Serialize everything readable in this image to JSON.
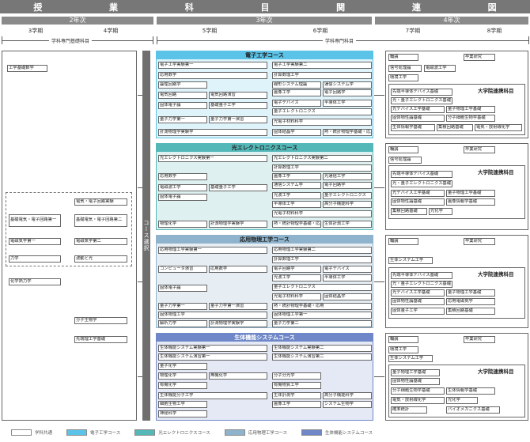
{
  "title_chars": [
    "授",
    "業",
    "科",
    "目",
    "関",
    "連",
    "図"
  ],
  "years": [
    "2年次",
    "3年次",
    "4年次"
  ],
  "semesters": [
    "3学期",
    "4学期",
    "5学期",
    "6学期",
    "7学期",
    "8学期"
  ],
  "labels": {
    "basic": "学科専門基礎科目",
    "major": "学科専門科目",
    "course_select": "コース選択"
  },
  "left_boxes": {
    "kiso_sugaku": "工学基礎数学",
    "denki_jikken": "電気・電子回路実験",
    "kiso_kairo1": "基礎電気・電子回路第一",
    "kiso_kairo2": "基礎電気・電子回路第二",
    "denji1": "電磁気学第一",
    "denji2": "電磁気学第二",
    "rikigaku": "力学",
    "hado": "波動と光",
    "kagaku": "化学熱力学",
    "bunshi_seibutsu": "分子生物学",
    "sensin": "先端理工学基礎"
  },
  "courses": [
    {
      "name": "電子工学コース"
    },
    {
      "name": "光エレクトロニクスコース"
    },
    {
      "name": "応用物理工学コース"
    },
    {
      "name": "生体機能システムコース"
    }
  ],
  "c1": {
    "b1": "電子工学実験第一",
    "b2": "電子工学実験第二",
    "b3": "応用数学",
    "b4": "計算数理工学",
    "b5": "論理回路学",
    "b6": "線形システム理論",
    "b7": "通信システム学",
    "b8": "電気回路",
    "b9": "電気回路演習",
    "b10": "画像工学",
    "b11": "電子回路学",
    "b12": "固体電子論",
    "b13": "基礎量子工学",
    "b14": "電子デバイス",
    "b15": "半導体工学",
    "b16": "量子エレクトロニクス",
    "b17": "量子力学第一",
    "b18": "量子力学第一演習",
    "b19": "光電子材料科学",
    "b20": "計測物理学実験学",
    "b21": "固体結晶学",
    "b22": "熱・統計物理学基礎・応用"
  },
  "c2": {
    "b1": "光エレクトロニクス実験第一",
    "b2": "光エレクトロニクス実験第二",
    "b3": "計算数理工学",
    "b4": "応用数学",
    "b5": "画像工学",
    "b6": "光通信工学",
    "b7": "電磁波工学",
    "b8": "基礎量子工学",
    "b9": "通信システム学",
    "b10": "電子回路学",
    "b11": "固体電子論",
    "b12": "光波工学",
    "b13": "量子エレクトロニクス",
    "b14": "半導体工学",
    "b15": "高分子機能科学",
    "b16": "光電子材料科学",
    "b17": "物理化学",
    "b18": "計測物理学実験学",
    "b19": "熱・統計物理学基礎・応用",
    "b20": "生体計測工学"
  },
  "c3": {
    "b1": "応用物理工学実験第一",
    "b2": "応用物理工学実験第二",
    "b3": "計算数理工学",
    "b4": "コンピュータ演習",
    "b5": "応用数学",
    "b6": "電子回路学",
    "b7": "電子デバイス",
    "b8": "光波工学",
    "b9": "半導体工学",
    "b10": "固体電子論",
    "b11": "量子エレクトロニクス",
    "b12": "光電子材料科学",
    "b13": "固体結晶学",
    "b14": "量子力学第一",
    "b15": "量子力学第一演習",
    "b16": "熱・統計物理学基礎・応用",
    "b17": "固体物理工学",
    "b18": "固体物理工学第一",
    "b19": "解析力学",
    "b20": "計測物理学実験学",
    "b21": "量子力学第二"
  },
  "c4": {
    "b1": "生体機能システム実験第一",
    "b2": "生体機能システム実験第二",
    "b3": "生体機能システム演習第一",
    "b4": "生体機能システム演習第二",
    "b5": "量子化学",
    "b6": "物理化学",
    "b7": "無機化学",
    "b8": "分子分光学",
    "b9": "有機化学",
    "b10": "有機物質工学",
    "b11": "生体機能分子工学",
    "b12": "生体計測学",
    "b13": "高分子機能科学",
    "b14": "細胞生物工学",
    "b15": "画像工学",
    "b16": "システム生物学",
    "b17": "神経科学"
  },
  "y4": {
    "r1": {
      "rindoku": "輪講",
      "sotsuken": "卒業研究",
      "a": "信号処理論",
      "b": "電磁波工学",
      "c": "環境工学",
      "grad": "大学院連携科目",
      "g1": "先端半導体デバイス基礎",
      "g2": "光・量子エレクトロニクス基礎",
      "g3": "光デバイス工学基礎",
      "g4": "量子物理工学基礎",
      "g5": "固体物性論基礎",
      "g6": "分子細胞生物学基礎",
      "g7": "生体情報学基礎",
      "g8": "集積回路基礎",
      "g9": "電気・放射線化学"
    },
    "r2": {
      "rindoku": "輪講",
      "sotsuken": "卒業研究",
      "a": "信号処理論",
      "grad": "大学院連携科目",
      "g1": "先端半導体デバイス基礎",
      "g2": "光・量子エレクトロニクス基礎",
      "g3": "光デバイス工学基礎",
      "g4": "量子物理工学基礎",
      "g5": "固体物性論基礎",
      "g6": "画像情報学基礎",
      "g7": "集積回路基礎",
      "g8": "光化学"
    },
    "r3": {
      "rindoku": "輪講",
      "sotsuken": "卒業研究",
      "a": "生体システム工学",
      "grad": "大学院連携科目",
      "g1": "先端半導体デバイス基礎",
      "g2": "光・量子エレクトロニクス基礎",
      "g3": "光デバイス工学基礎",
      "g4": "量子物理工学基礎",
      "g5": "固体物性論基礎",
      "g6": "応用電磁気学",
      "g7": "固体量子工学",
      "g8": "集積回路基礎"
    },
    "r4": {
      "rindoku": "輪講",
      "sotsuken": "卒業研究",
      "a": "環境工学",
      "b": "生体システム工学",
      "grad": "大学院連携科目",
      "g1": "量子物理工学基礎",
      "g2": "固体物性論基礎",
      "g3": "分子細胞生物学基礎",
      "g4": "生体情報学基礎",
      "g5": "電気・放射線化学",
      "g6": "光化学",
      "g7": "確率統計",
      "g8": "バイオメカニクス基礎"
    }
  },
  "legend": [
    "学科共通",
    "電子工学コース",
    "光エレクトロニクスコース",
    "応用物理工学コース",
    "生体機能システムコース"
  ],
  "colors": {
    "header": "#777777",
    "c1": "#5bc3e8",
    "c2": "#54b8b8",
    "c3": "#8fb3cc",
    "c4": "#6f87c8"
  }
}
